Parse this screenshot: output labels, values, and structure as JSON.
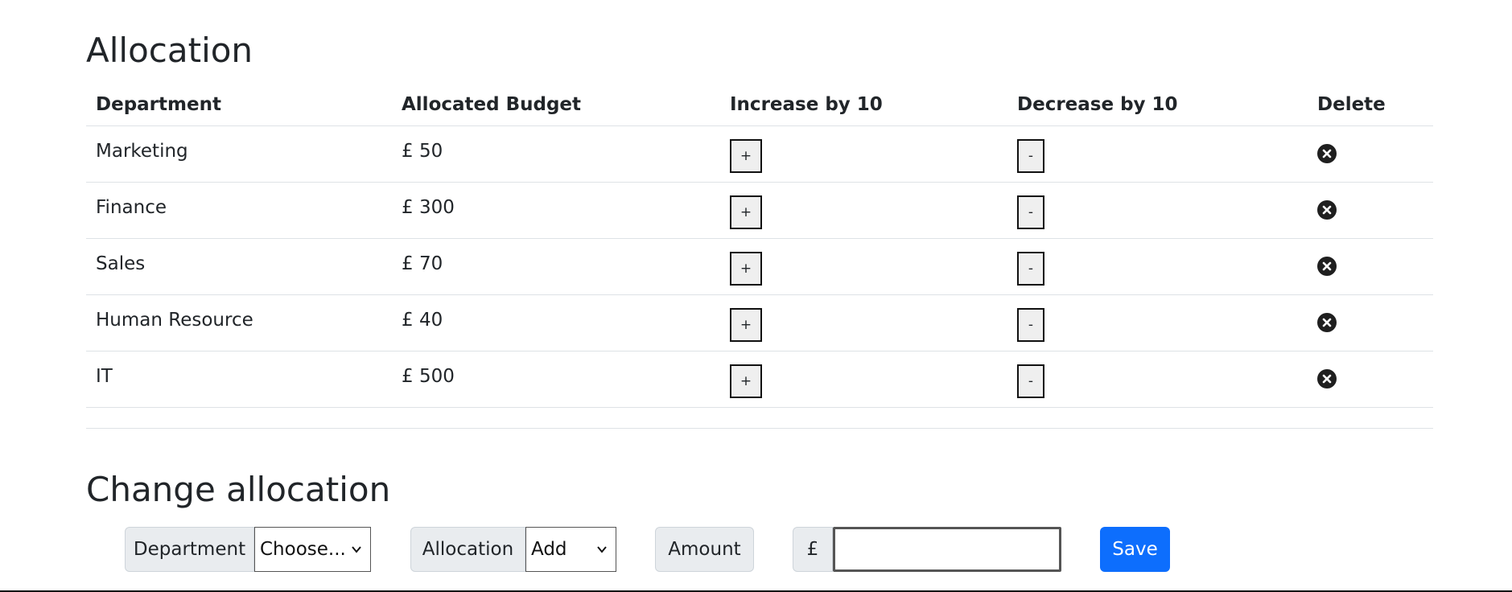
{
  "allocation": {
    "title": "Allocation",
    "headers": {
      "department": "Department",
      "budget": "Allocated Budget",
      "increase": "Increase by 10",
      "decrease": "Decrease by 10",
      "delete": "Delete"
    },
    "rows": [
      {
        "department": "Marketing",
        "budget": "£ 50",
        "increase": "+",
        "decrease": "-"
      },
      {
        "department": "Finance",
        "budget": "£ 300",
        "increase": "+",
        "decrease": "-"
      },
      {
        "department": "Sales",
        "budget": "£ 70",
        "increase": "+",
        "decrease": "-"
      },
      {
        "department": "Human Resource",
        "budget": "£ 40",
        "increase": "+",
        "decrease": "-"
      },
      {
        "department": "IT",
        "budget": "£ 500",
        "increase": "+",
        "decrease": "-"
      }
    ],
    "delete_icon": "close-circle-icon"
  },
  "change_allocation": {
    "title": "Change allocation",
    "department_label": "Department",
    "department_select": "Choose...",
    "allocation_label": "Allocation",
    "allocation_select": "Add",
    "amount_label": "Amount",
    "currency_label": "£",
    "amount_value": "",
    "save_label": "Save"
  },
  "colors": {
    "primary": "#0d6efd",
    "input_group_bg": "#e9ecef",
    "text": "#212529",
    "border": "#dee2e6"
  }
}
